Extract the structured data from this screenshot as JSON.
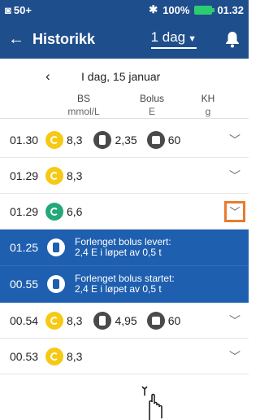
{
  "status_bar": {
    "left_text": "50+",
    "battery": "100%",
    "time": "01.32"
  },
  "app_bar": {
    "title": "Historikk",
    "range": "1 dag"
  },
  "date_nav": {
    "date": "I dag, 15 januar"
  },
  "columns": [
    {
      "label": "BS",
      "unit": "mmol/L"
    },
    {
      "label": "Bolus",
      "unit": "E"
    },
    {
      "label": "KH",
      "unit": "g"
    }
  ],
  "rows": [
    {
      "time": "01.30",
      "bs": "8,3",
      "bs_color": "yellow",
      "bolus": "2,35",
      "carbs": "60"
    },
    {
      "time": "01.29",
      "bs": "8,3",
      "bs_color": "yellow"
    },
    {
      "time": "01.29",
      "bs": "6,6",
      "bs_color": "green",
      "highlight_chevron": true
    }
  ],
  "bolus_events": [
    {
      "time": "01.25",
      "line1": "Forlenget bolus levert:",
      "line2": "2,4 E i løpet av 0,5 t"
    },
    {
      "time": "00.55",
      "line1": "Forlenget bolus startet:",
      "line2": "2,4 E i løpet av 0,5 t"
    }
  ],
  "rows2": [
    {
      "time": "00.54",
      "bs": "8,3",
      "bolus": "4,95",
      "carbs": "60"
    },
    {
      "time": "00.53",
      "bs": "8,3"
    }
  ],
  "colors": {
    "primary": "#1f4e8c",
    "event_blue": "#1f5fb0",
    "bs_yellow": "#f6c915",
    "bs_green": "#23a87a",
    "highlight": "#e87c2e"
  }
}
